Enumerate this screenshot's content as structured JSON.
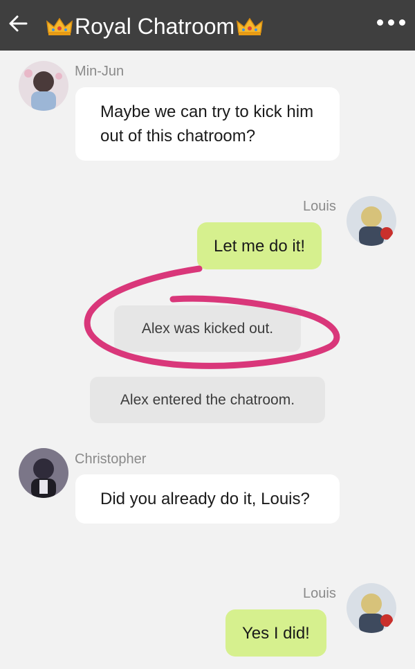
{
  "header": {
    "title": "Royal Chatroom",
    "back_icon": "arrow-left-icon",
    "menu_icon": "more-horizontal-icon",
    "crown_icon": "crown-emoji"
  },
  "messages": [
    {
      "sender": "Min-Jun",
      "text": "Maybe we can try to kick him out of this chatroom?",
      "side": "left"
    },
    {
      "sender": "Louis",
      "text": "Let me do it!",
      "side": "right"
    },
    {
      "type": "system",
      "text": "Alex was kicked out."
    },
    {
      "type": "system",
      "text": "Alex entered the chatroom."
    },
    {
      "sender": "Christopher",
      "text": "Did you already do it, Louis?",
      "side": "left"
    },
    {
      "sender": "Louis",
      "text": "Yes I did!",
      "side": "right"
    }
  ],
  "colors": {
    "header_bg": "#3f3f3f",
    "background": "#f2f2f2",
    "outgoing_bubble": "#d6f08e",
    "incoming_bubble": "#ffffff",
    "system_bubble": "#e6e6e6",
    "annotation_circle": "#d9377a"
  }
}
